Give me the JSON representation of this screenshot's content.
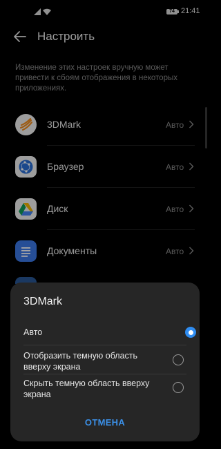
{
  "status": {
    "battery": "74",
    "time": "21:41"
  },
  "header": {
    "title": "Настроить"
  },
  "description": "Изменение этих настроек вручную может привести к сбоям отображения в некоторых приложениях.",
  "apps": [
    {
      "name": "3DMark",
      "value": "Авто",
      "icon": "3dmark-icon"
    },
    {
      "name": "Браузер",
      "value": "Авто",
      "icon": "browser-icon"
    },
    {
      "name": "Диск",
      "value": "Авто",
      "icon": "drive-icon"
    },
    {
      "name": "Документы",
      "value": "Авто",
      "icon": "docs-icon"
    }
  ],
  "dialog": {
    "title": "3DMark",
    "options": [
      {
        "label": "Авто",
        "selected": true
      },
      {
        "label": "Отобразить темную область вверху экрана",
        "selected": false
      },
      {
        "label": "Скрыть темную область вверху экрана",
        "selected": false
      }
    ],
    "cancel": "ОТМЕНА"
  },
  "colors": {
    "accent": "#2f8cf0",
    "background": "#000000",
    "sheet": "#262626"
  }
}
